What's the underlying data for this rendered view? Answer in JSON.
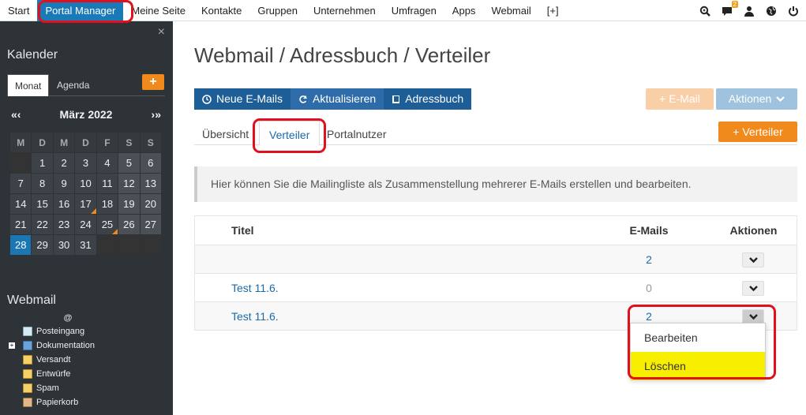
{
  "topnav": {
    "items": [
      "Start",
      "Portal Manager",
      "Meine Seite",
      "Kontakte",
      "Gruppen",
      "Unternehmen",
      "Umfragen",
      "Apps",
      "Webmail",
      "[+]"
    ],
    "active_index": 1,
    "notification_count": "2"
  },
  "sidebar": {
    "close": "×",
    "calendar": {
      "title": "Kalender",
      "tabs": [
        "Monat",
        "Agenda"
      ],
      "add": "+",
      "prev": "«‹",
      "next": "›»",
      "month": "März 2022",
      "weekdays": [
        "M",
        "D",
        "M",
        "D",
        "F",
        "S",
        "S"
      ],
      "weeks": [
        [
          "",
          "1",
          "2",
          "3",
          "4",
          "5",
          "6"
        ],
        [
          "7",
          "8",
          "9",
          "10",
          "11",
          "12",
          "13"
        ],
        [
          "14",
          "15",
          "16",
          "17",
          "18",
          "19",
          "20"
        ],
        [
          "21",
          "22",
          "23",
          "24",
          "25",
          "26",
          "27"
        ],
        [
          "28",
          "29",
          "30",
          "31",
          "",
          "",
          ""
        ]
      ],
      "today": "28",
      "event_days": [
        "17",
        "25"
      ]
    },
    "webmail": {
      "title": "Webmail",
      "account": "@",
      "folders": [
        "Posteingang",
        "Dokumentation",
        "Versandt",
        "Entwürfe",
        "Spam",
        "Papierkorb"
      ]
    }
  },
  "main": {
    "title": "Webmail / Adressbuch / Verteiler",
    "buttons": {
      "new_mails": "Neue E-Mails",
      "refresh": "Aktualisieren",
      "addressbook": "Adressbuch",
      "email": "+ E-Mail",
      "actions": "Aktionen",
      "add_list": "+ Verteiler"
    },
    "tabs": [
      "Übersicht",
      "Verteiler",
      "Portalnutzer"
    ],
    "info": "Hier können Sie die Mailingliste als Zusammenstellung mehrerer E-Mails erstellen und bearbeiten.",
    "table": {
      "headers": [
        "Titel",
        "E-Mails",
        "Aktionen"
      ],
      "rows": [
        {
          "title": "",
          "emails": "2"
        },
        {
          "title": "Test 11.6.",
          "emails": "0"
        },
        {
          "title": "Test 11.6.",
          "emails": "2"
        }
      ]
    },
    "dropdown": [
      "Bearbeiten",
      "Löschen"
    ]
  },
  "colors": {
    "nav_active": "#1a7ab8",
    "sidebar_bg": "#2e3338",
    "button_dark": "#1e5e96",
    "orange": "#f08a1c",
    "highlight": "#f8ee00",
    "annotation": "#e0101c"
  }
}
